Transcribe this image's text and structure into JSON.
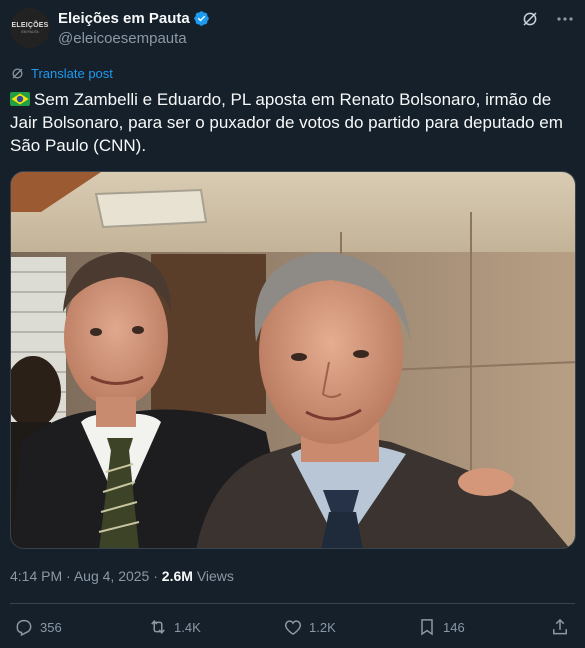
{
  "author": {
    "display_name": "Eleições em Pauta",
    "handle": "@eleicoesempauta",
    "avatar_text": "ELEIÇÕES",
    "avatar_subtext": "EM PAUTA"
  },
  "translate_label": "Translate post",
  "post": {
    "text": "Sem Zambelli e Eduardo, PL aposta em Renato Bolsonaro, irmão de Jair Bolsonaro, para ser o puxador de votos do partido para deputado em São Paulo (CNN)."
  },
  "meta": {
    "time": "4:14 PM",
    "separator": "·",
    "date": "Aug 4, 2025",
    "views_count": "2.6M",
    "views_label": "Views"
  },
  "actions": {
    "replies": "356",
    "reposts": "1.4K",
    "likes": "1.2K",
    "bookmarks": "146"
  },
  "colors": {
    "background": "#15202b",
    "text": "#f7f9f9",
    "secondary": "#8b98a5",
    "accent": "#1d9bf0",
    "divider": "#38444d"
  },
  "icons": [
    "verified-badge-icon",
    "grok-icon",
    "more-icon",
    "translate-icon",
    "reply-icon",
    "repost-icon",
    "like-icon",
    "bookmark-icon",
    "share-icon"
  ]
}
